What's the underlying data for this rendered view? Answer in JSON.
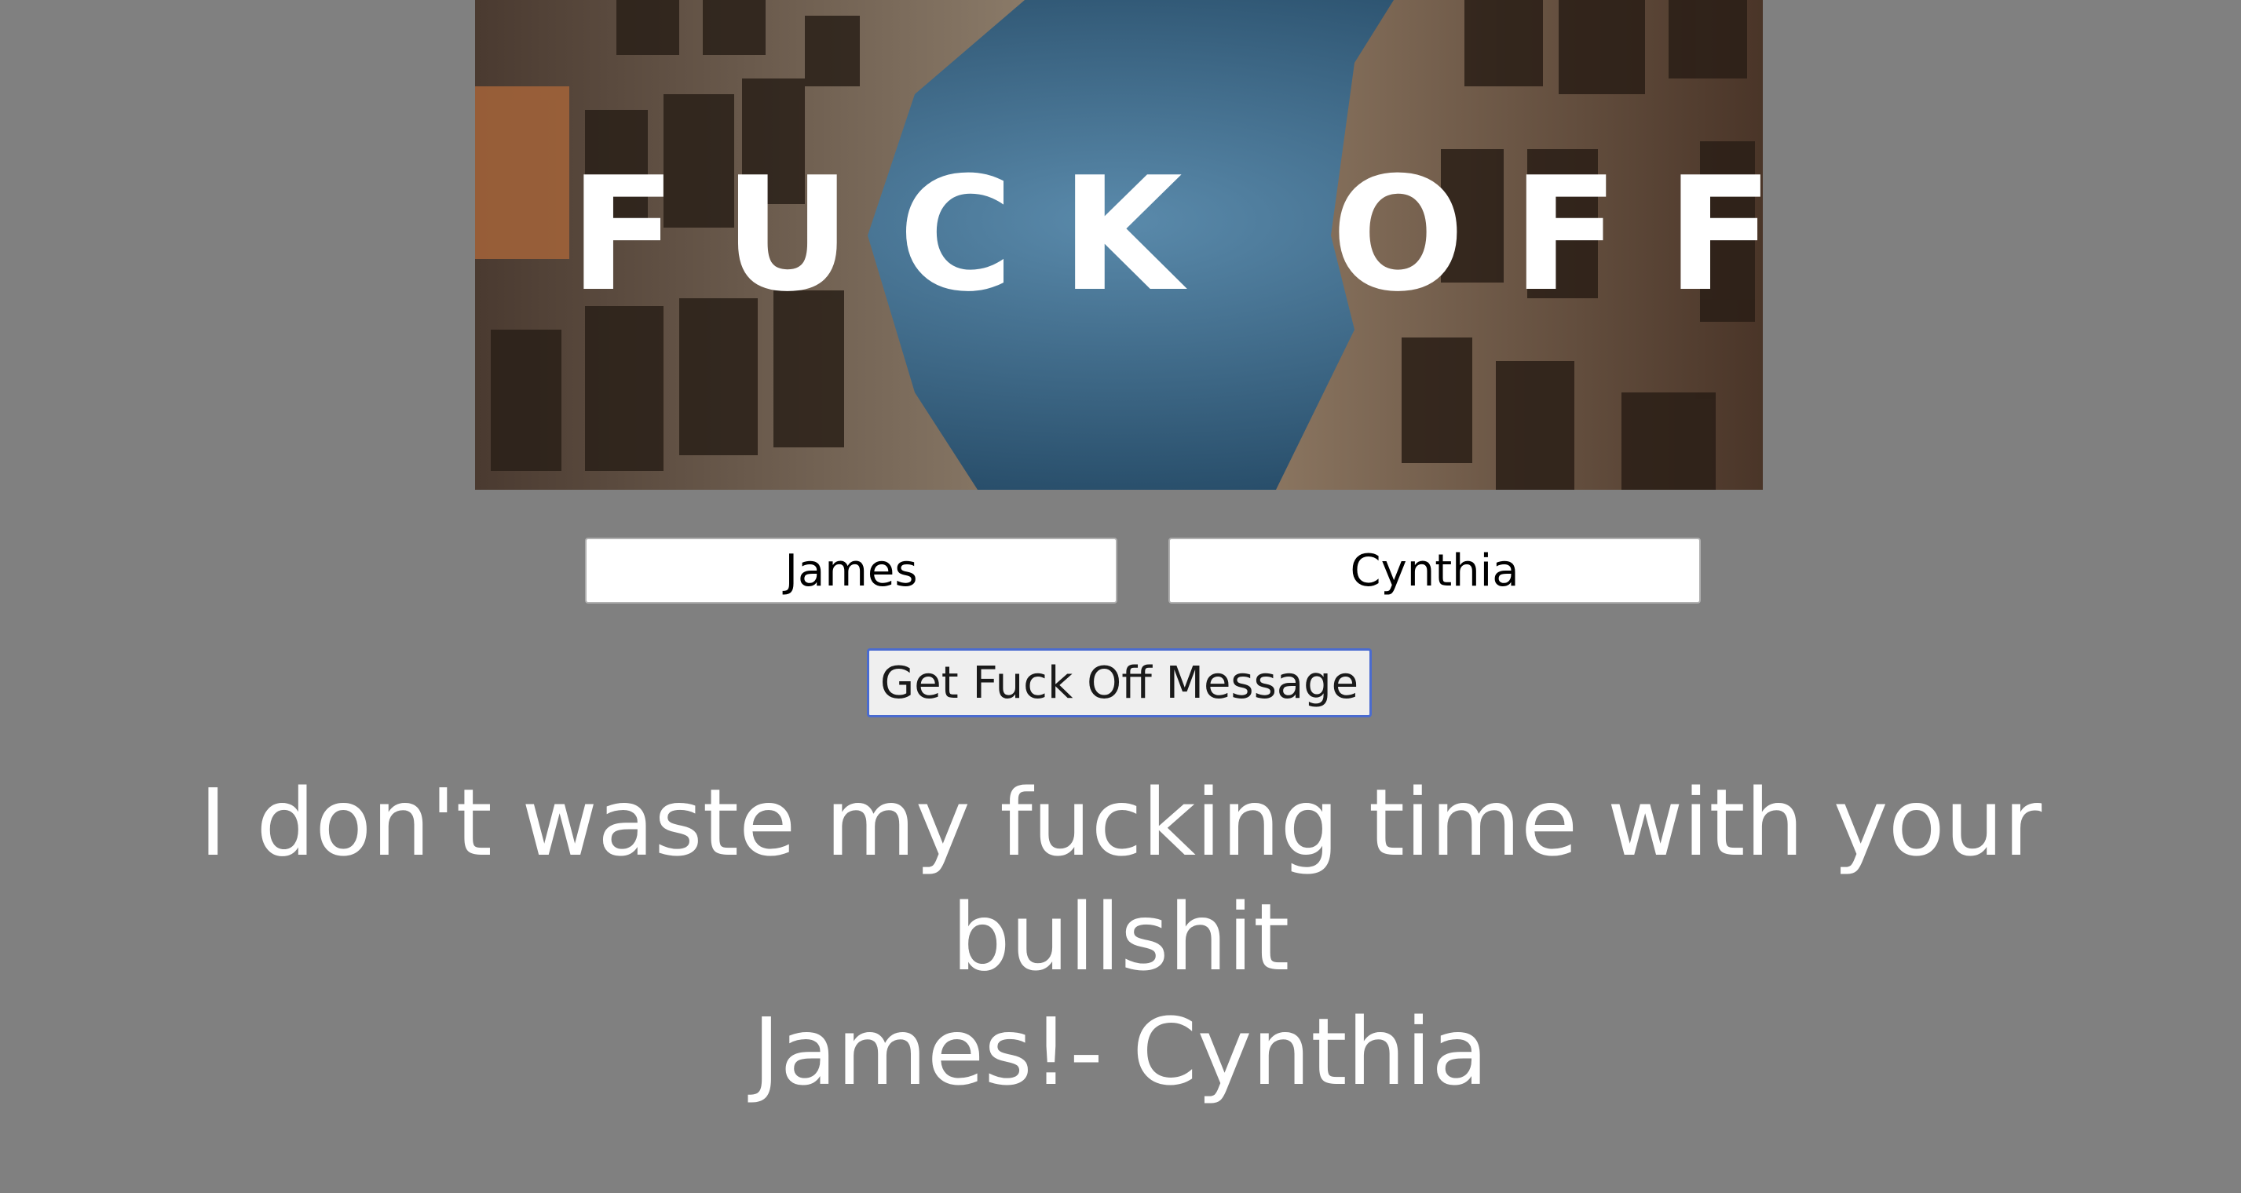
{
  "banner": {
    "text": "FUCK OFF",
    "sky_color": "#3d6e8f",
    "building_color_left": "#6d5a4a",
    "building_color_right": "#8a6a55"
  },
  "form": {
    "from_value": "James",
    "to_value": "Cynthia",
    "submit_label": "Get Fuck Off Message"
  },
  "result": {
    "line1": "I don't waste my fucking time with your bullshit",
    "line2": "James!- Cynthia"
  },
  "colors": {
    "background": "#808080",
    "text": "#ffffff",
    "button_border": "#4a6bd0"
  }
}
